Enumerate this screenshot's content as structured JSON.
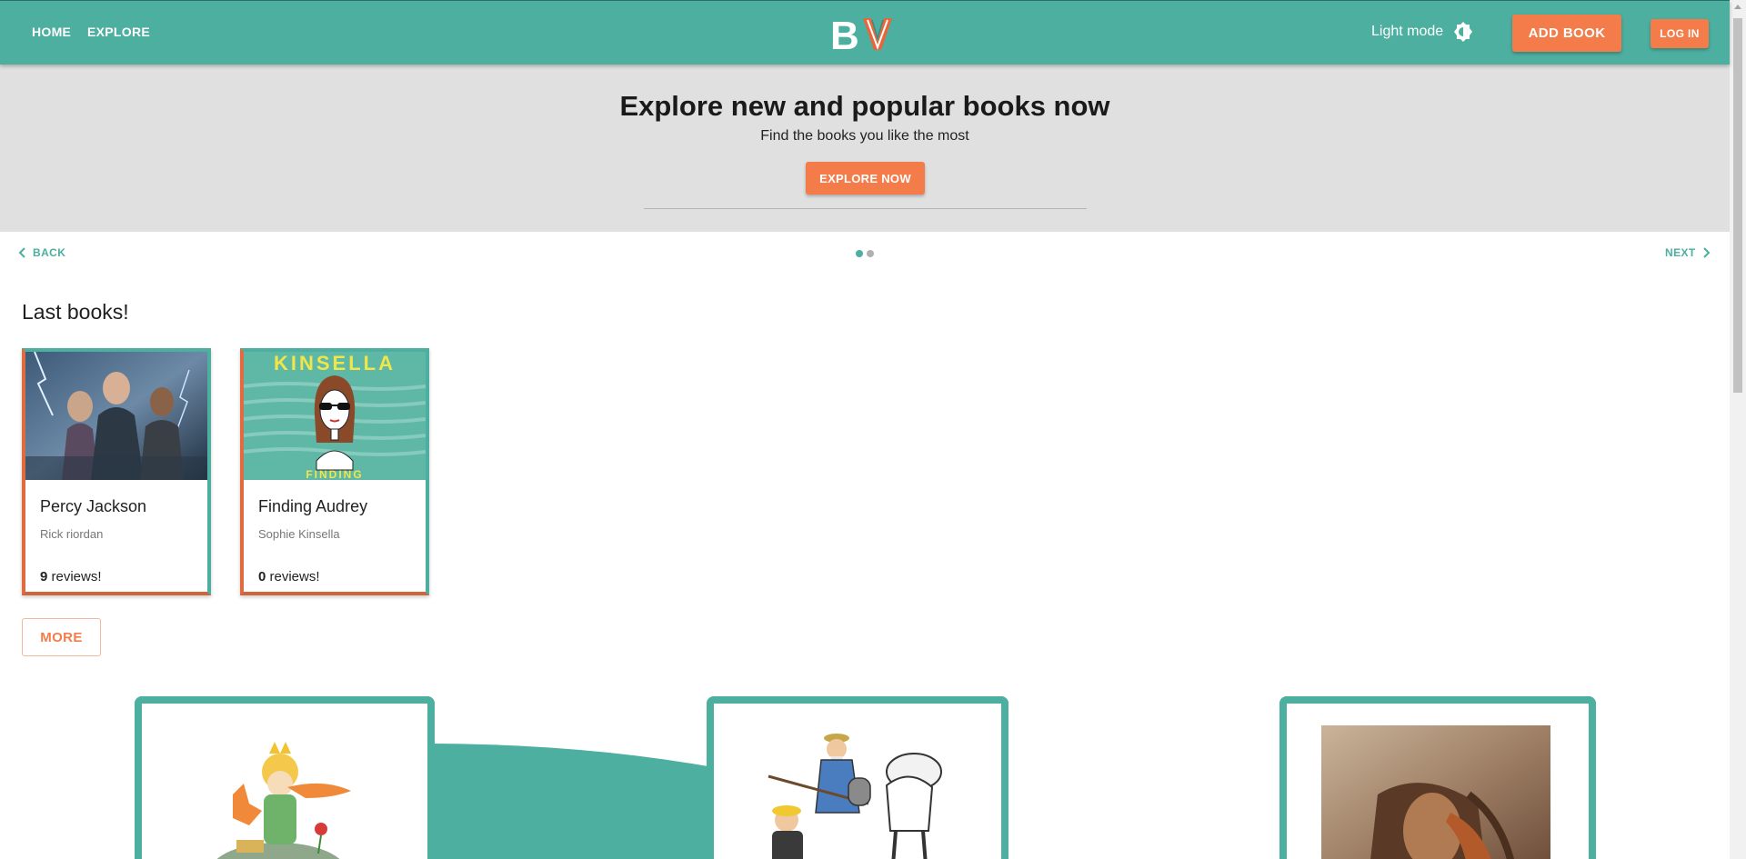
{
  "header": {
    "nav": {
      "home": "HOME",
      "explore": "EXPLORE"
    },
    "logo_text": "BV",
    "theme_toggle_label": "Light mode",
    "theme_icon": "brightness-icon",
    "add_book_label": "ADD BOOK",
    "login_label": "LOG IN"
  },
  "hero": {
    "title": "Explore new and popular books now",
    "subtitle": "Find the books you like the most",
    "cta_label": "EXPLORE NOW"
  },
  "carousel": {
    "back_label": "BACK",
    "next_label": "NEXT",
    "dots": 2,
    "active_index": 0
  },
  "last_books": {
    "title": "Last books!",
    "reviews_suffix": " reviews!",
    "items": [
      {
        "title": "Percy Jackson",
        "author": "Rick riordan",
        "reviews": "9"
      },
      {
        "title": "Finding Audrey",
        "author": "Sophie Kinsella",
        "reviews": "0",
        "cover_text_top": "KINSELLA",
        "cover_text_bottom": "FINDING"
      }
    ],
    "more_label": "MORE"
  },
  "colors": {
    "primary": "#4caf9f",
    "accent": "#f47c4a",
    "hero_bg": "#e0e0e0"
  }
}
